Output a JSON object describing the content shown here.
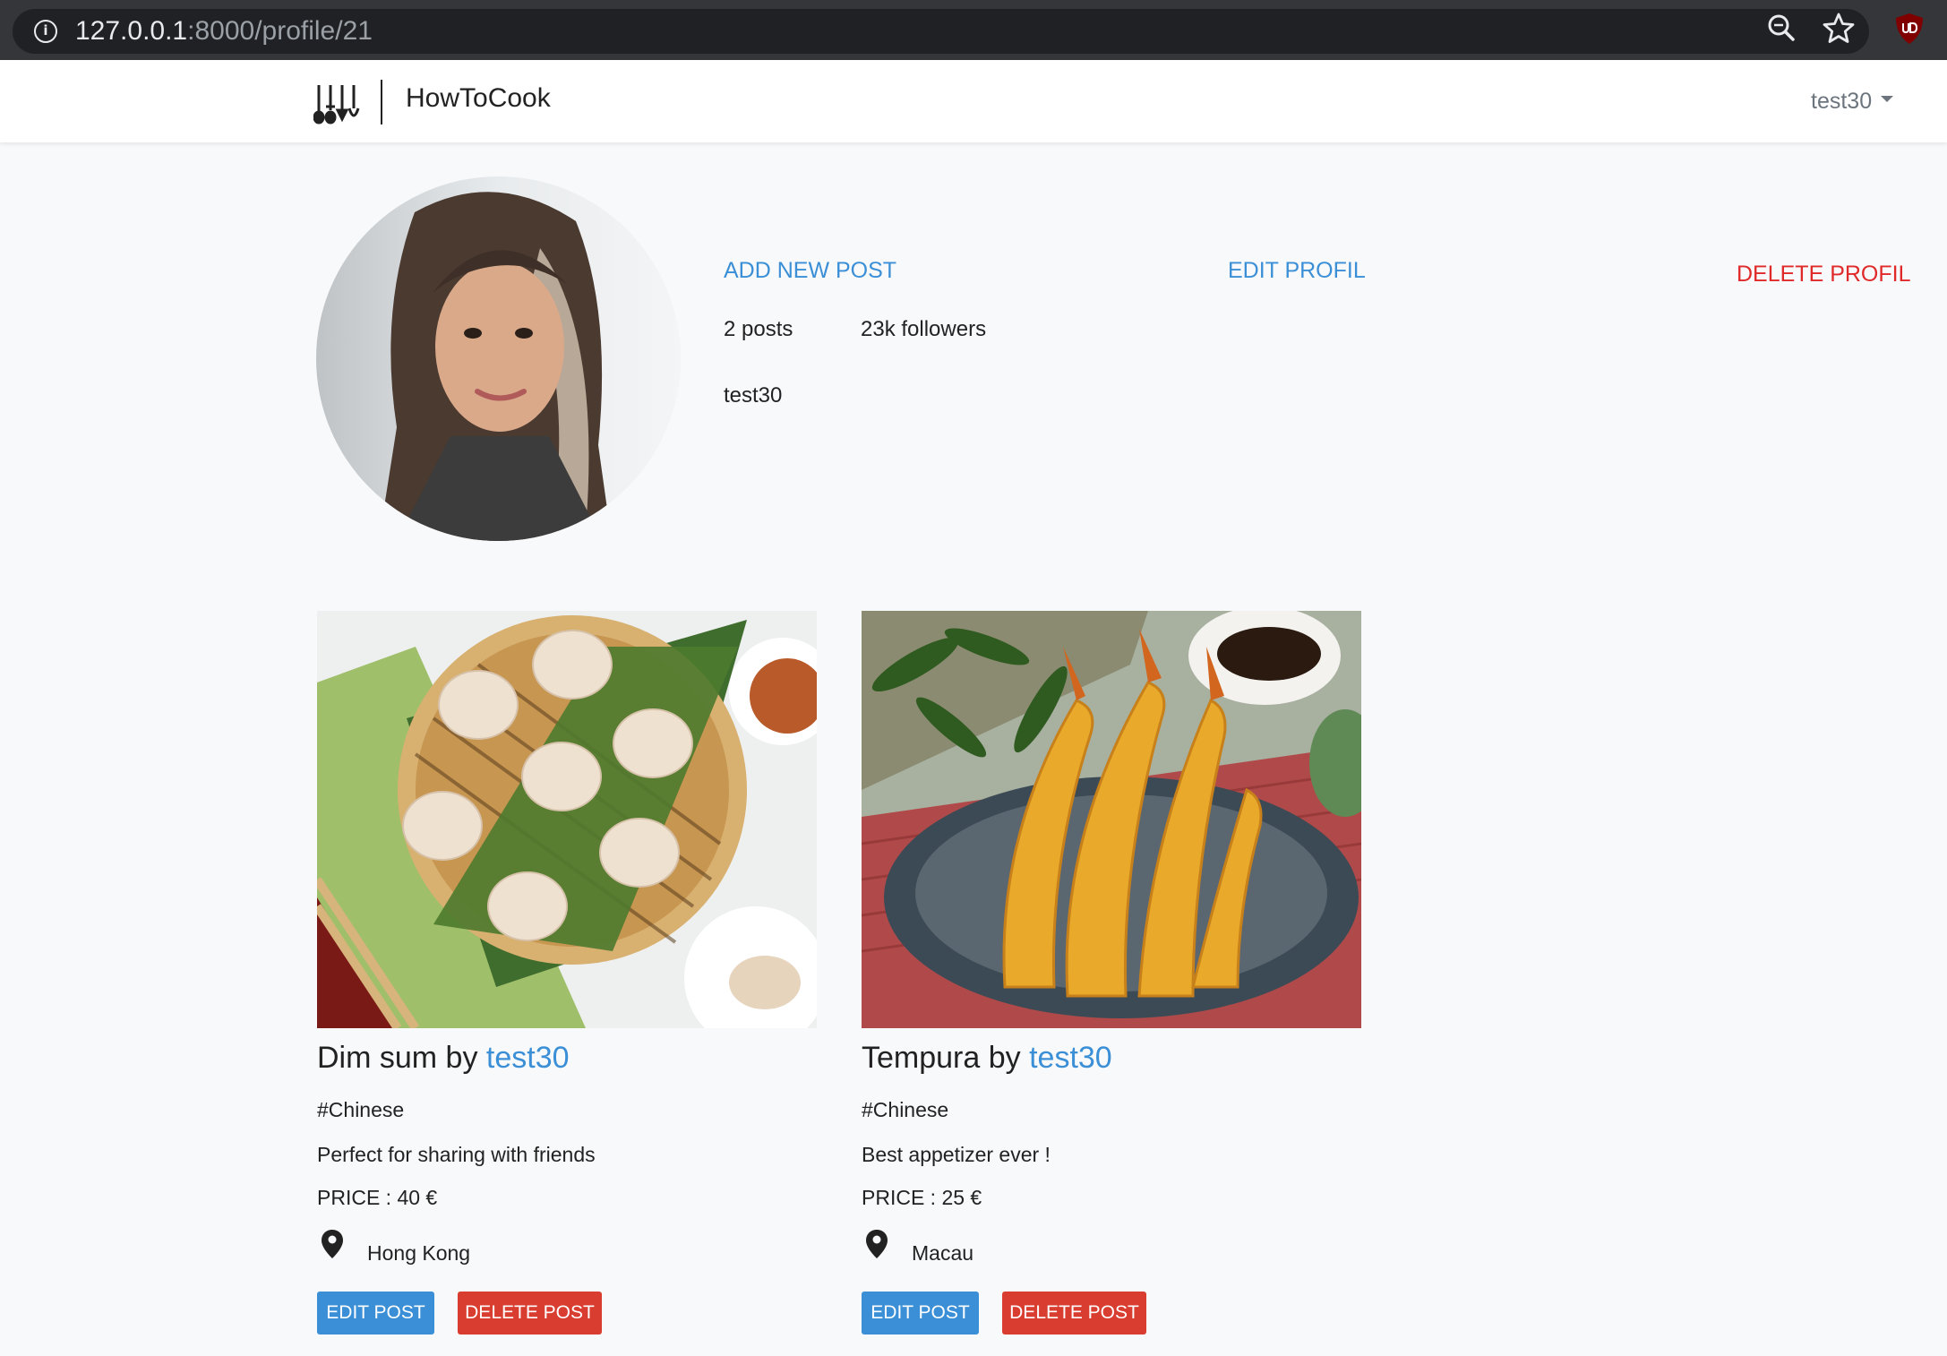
{
  "browser": {
    "url_host": "127.0.0.1",
    "url_path": ":8000/profile/21",
    "info_icon": "i"
  },
  "navbar": {
    "brand": "HowToCook",
    "user": "test30"
  },
  "profile": {
    "add_post": "ADD NEW POST",
    "edit_profile": "EDIT PROFIL",
    "delete_profile": "DELETE PROFIL",
    "posts": "2 posts",
    "followers": "23k followers",
    "username": "test30"
  },
  "posts": [
    {
      "dish": "Dim sum",
      "by": " by ",
      "author": "test30",
      "tag": "#Chinese",
      "description": "Perfect for sharing with friends",
      "price": "PRICE : 40 €",
      "location": "Hong Kong",
      "edit_label": "EDIT POST",
      "delete_label": "DELETE POST"
    },
    {
      "dish": "Tempura",
      "by": " by ",
      "author": "test30",
      "tag": "#Chinese",
      "description": "Best appetizer ever !",
      "price": "PRICE : 25 €",
      "location": "Macau",
      "edit_label": "EDIT POST",
      "delete_label": "DELETE POST"
    }
  ],
  "colors": {
    "link": "#3b8fd6",
    "danger": "#e02a2a",
    "button_edit": "#3b8fd6",
    "button_delete": "#d93d30"
  }
}
